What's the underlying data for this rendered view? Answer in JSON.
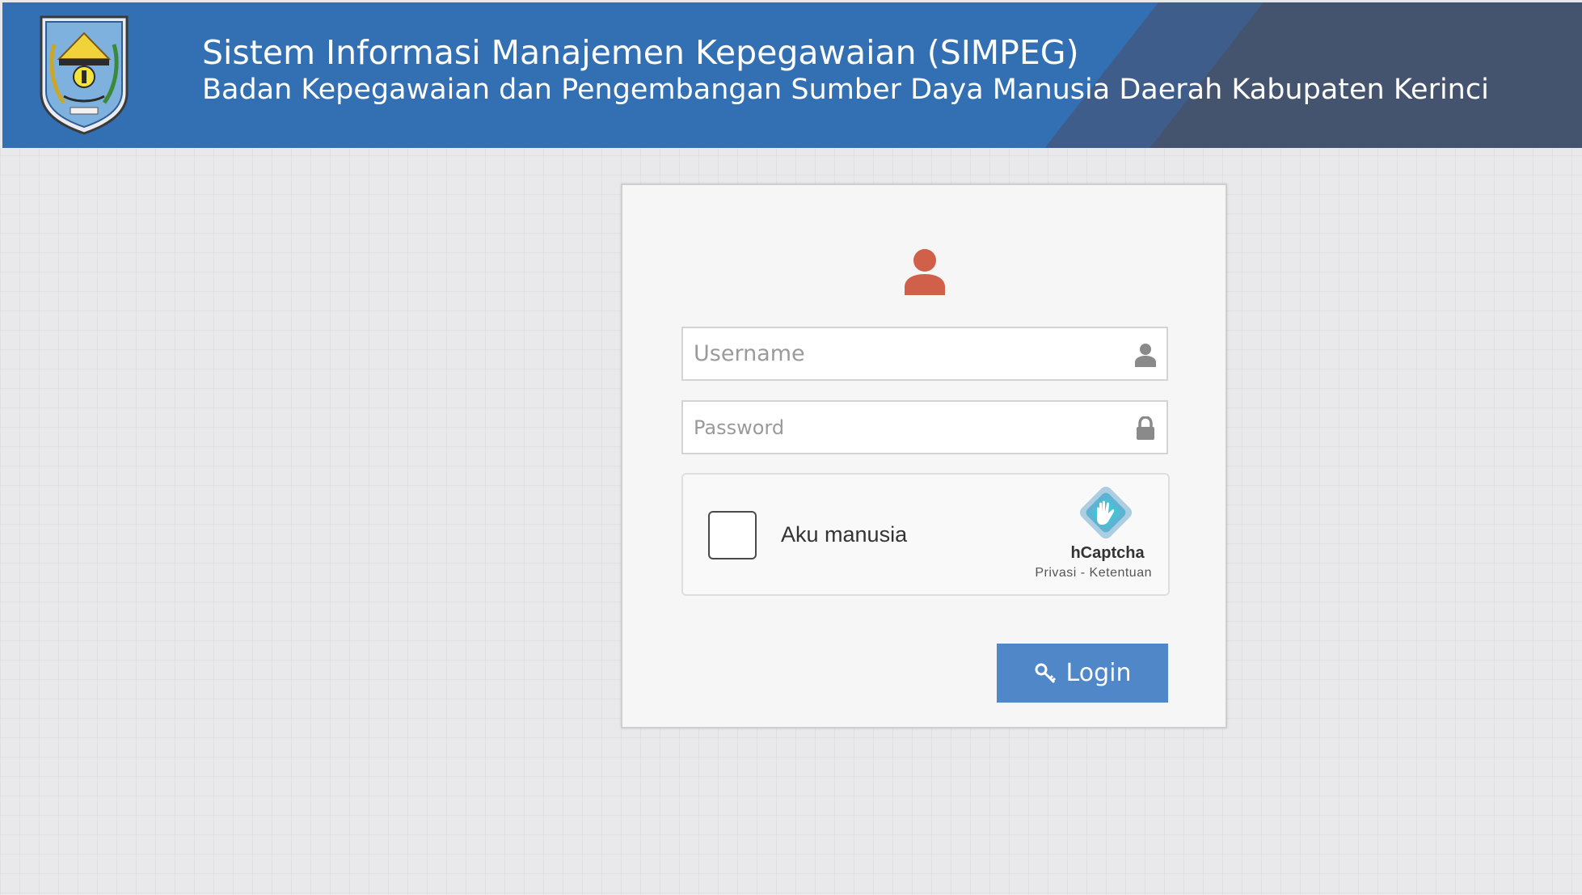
{
  "header": {
    "title": "Sistem Informasi Manajemen Kepegawaian (SIMPEG)",
    "subtitle": "Badan Kepegawaian dan Pengembangan Sumber Daya Manusia Daerah Kabupaten Kerinci",
    "logo_icon": "kerinci-regency-emblem",
    "colors": {
      "primary": "#3370b3",
      "band_mid": "#3f5d8a",
      "band_dark": "#44546f"
    }
  },
  "login": {
    "avatar_icon": "user-icon",
    "avatar_color": "#d0604a",
    "username": {
      "placeholder": "Username",
      "value": "",
      "icon": "user-icon"
    },
    "password": {
      "placeholder": "Password",
      "value": "",
      "icon": "lock-icon"
    },
    "captcha": {
      "label": "Aku manusia",
      "brand": "hCaptcha",
      "privacy": "Privasi",
      "separator": " - ",
      "terms": "Ketentuan",
      "checked": false
    },
    "submit": {
      "label": "Login",
      "icon": "key-icon",
      "color": "#4f87c9"
    }
  }
}
